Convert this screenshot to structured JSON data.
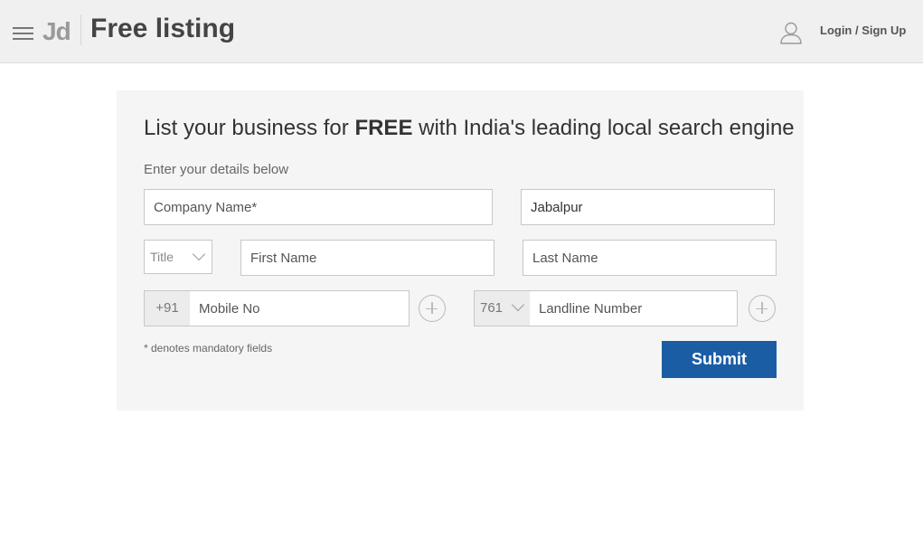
{
  "header": {
    "logo_text": "Jd",
    "title": "Free listing",
    "login_label": "Login / Sign Up"
  },
  "form": {
    "headline_pre": "List your business for ",
    "headline_bold": "FREE",
    "headline_post": " with India's leading local search engine",
    "subheading": "Enter your details below",
    "company_placeholder": "Company Name*",
    "city_value": "Jabalpur",
    "title_label": "Title",
    "first_name_placeholder": "First Name",
    "last_name_placeholder": "Last Name",
    "mobile_prefix": "+91",
    "mobile_placeholder": "Mobile No",
    "std_code": "761",
    "landline_placeholder": "Landline Number",
    "mandatory_note": "* denotes mandatory fields",
    "submit_label": "Submit"
  },
  "icons": {
    "menu": "hamburger-menu-icon",
    "user": "user-icon",
    "add": "plus-circle-icon",
    "dropdown": "chevron-down-icon"
  },
  "colors": {
    "primary": "#1b5da4",
    "header_bg": "#f0f0f0",
    "card_bg": "#f5f5f5"
  }
}
